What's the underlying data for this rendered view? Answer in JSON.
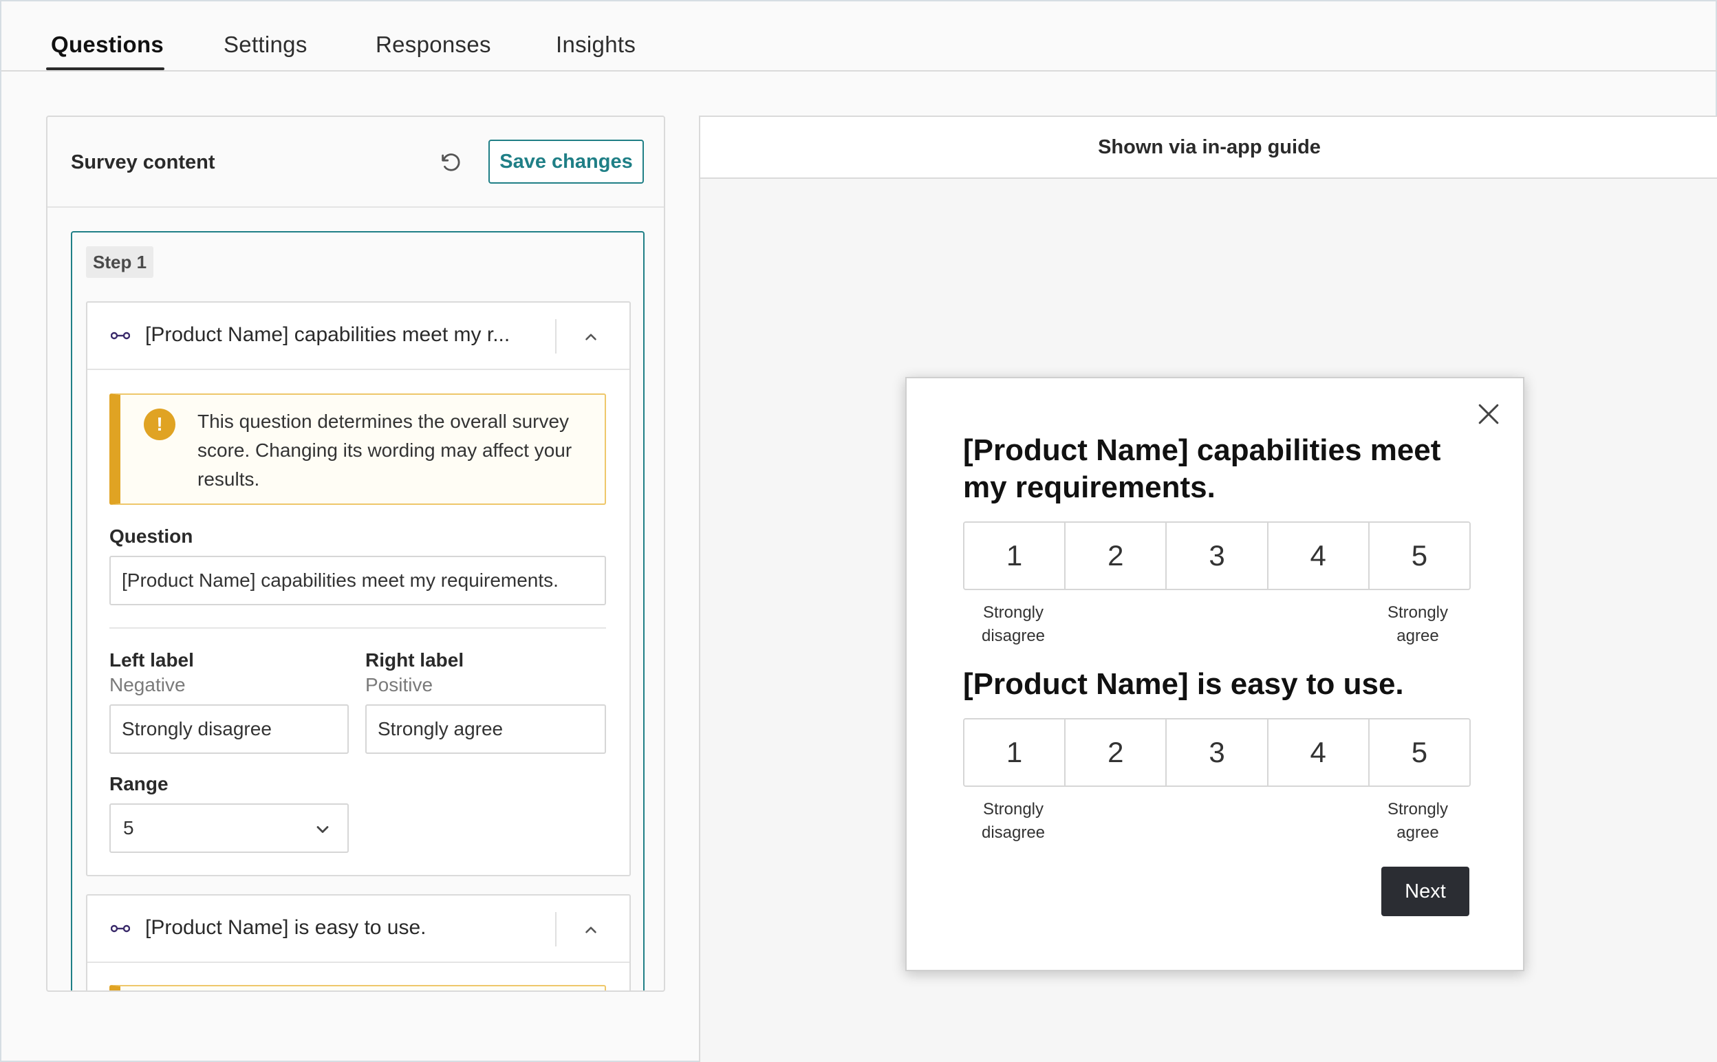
{
  "tabs": [
    {
      "label": "Questions",
      "active": true
    },
    {
      "label": "Settings",
      "active": false
    },
    {
      "label": "Responses",
      "active": false
    },
    {
      "label": "Insights",
      "active": false
    }
  ],
  "editor": {
    "title": "Survey content",
    "save_label": "Save changes",
    "step_label": "Step 1",
    "questions": [
      {
        "header": "[Product Name] capabilities meet my r...",
        "warning": "This question determines the overall survey score. Changing its wording may affect your results.",
        "question_label": "Question",
        "question_value": "[Product Name] capabilities meet my requirements.",
        "left_label": "Left label",
        "left_sub": "Negative",
        "left_value": "Strongly disagree",
        "right_label": "Right label",
        "right_sub": "Positive",
        "right_value": "Strongly agree",
        "range_label": "Range",
        "range_value": "5"
      },
      {
        "header": "[Product Name] is easy to use."
      }
    ]
  },
  "preview": {
    "header": "Shown via in-app guide",
    "questions": [
      {
        "text": "[Product Name] capabilities meet my requirements.",
        "options": [
          "1",
          "2",
          "3",
          "4",
          "5"
        ],
        "left": "Strongly disagree",
        "right": "Strongly agree"
      },
      {
        "text": "[Product Name] is easy to use.",
        "options": [
          "1",
          "2",
          "3",
          "4",
          "5"
        ],
        "left": "Strongly disagree",
        "right": "Strongly agree"
      }
    ],
    "next_label": "Next"
  },
  "colors": {
    "accent": "#1f7f86",
    "warning": "#e0a323",
    "dark_button": "#2b2d33"
  }
}
